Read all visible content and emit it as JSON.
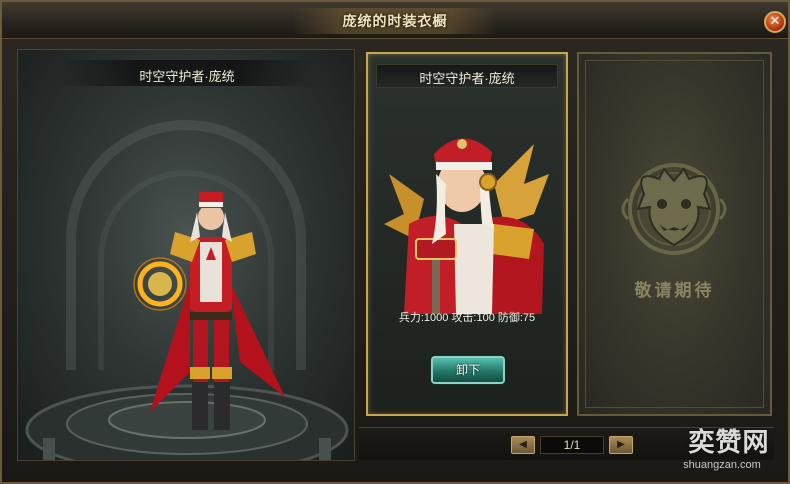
{
  "window": {
    "title": "庞统的时装衣橱",
    "close_icon": "close-icon"
  },
  "preview": {
    "name": "时空守护者·庞统"
  },
  "costume_card": {
    "name": "时空守护者·庞统",
    "stats": "兵力:1000 攻击:100 防御:75",
    "unequip_label": "卸下"
  },
  "locked_card": {
    "emblem_icon": "dragon-emblem-icon",
    "label": "敬请期待"
  },
  "pager": {
    "prev_icon": "arrow-left-icon",
    "next_icon": "arrow-right-icon",
    "page_text": "1/1"
  },
  "watermark": {
    "logo_text": "奕赞网",
    "url": "shuangzan.com"
  },
  "colors": {
    "frame_gold": "#c9a64c",
    "button_teal": "#237868",
    "close_red": "#b33a12"
  }
}
